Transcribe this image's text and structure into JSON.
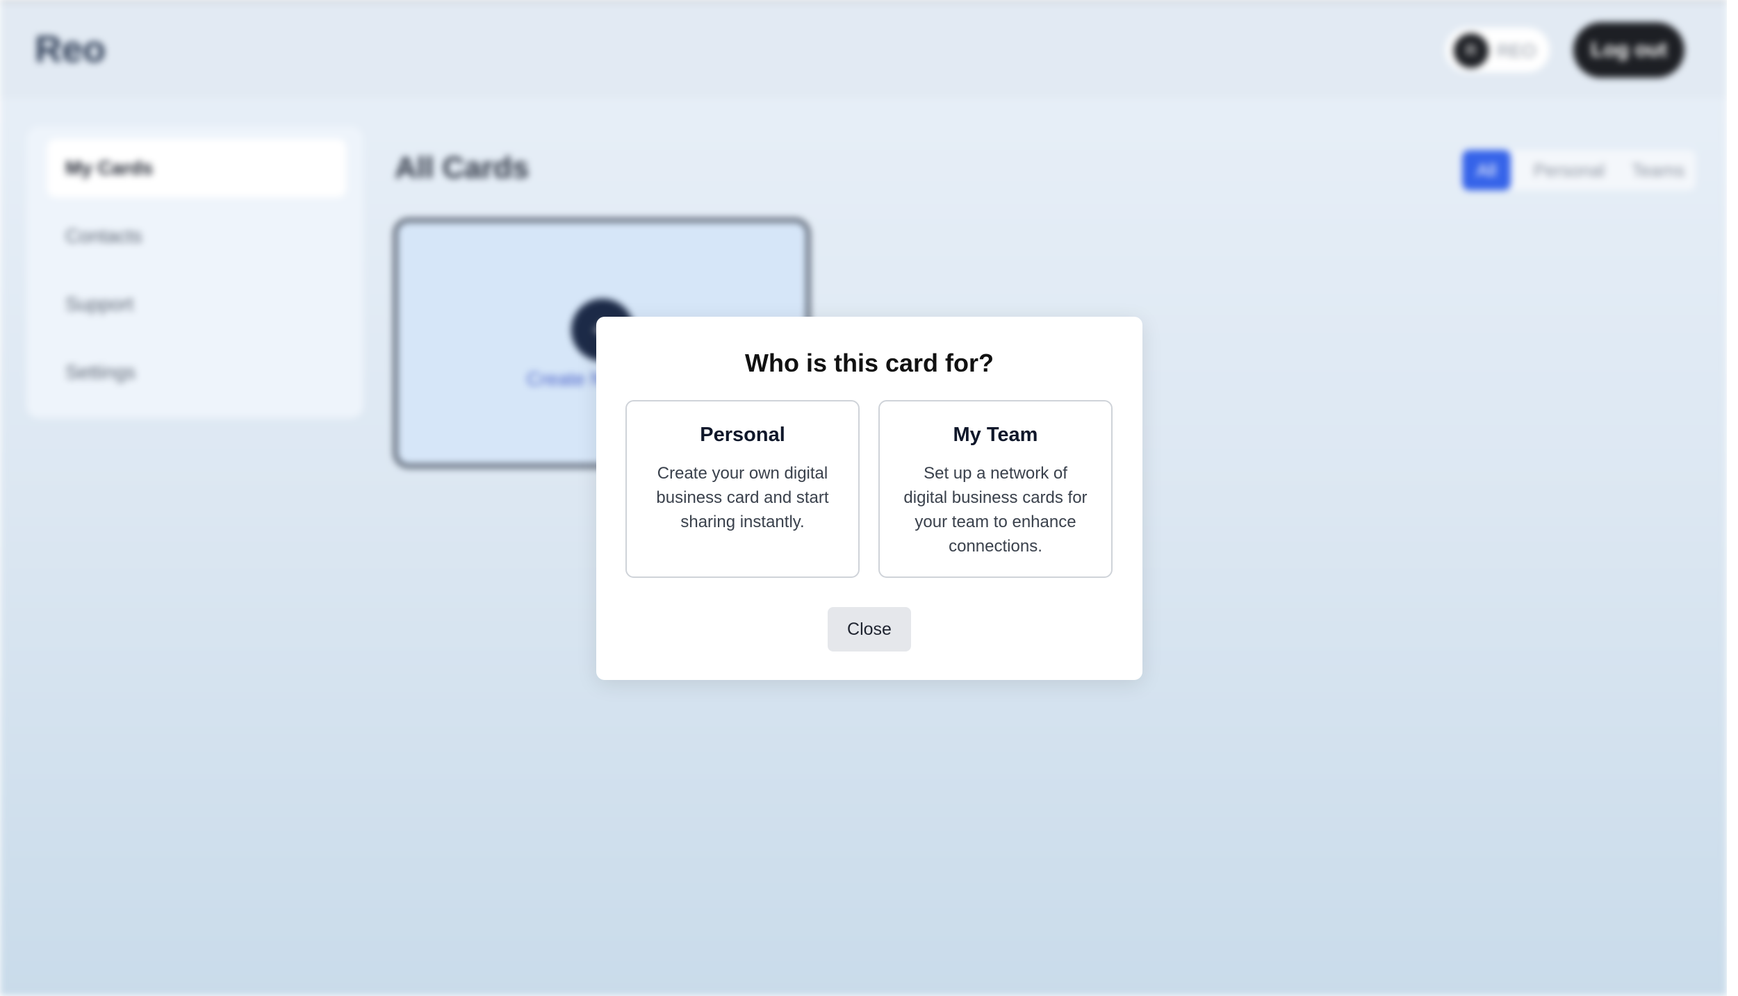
{
  "app": {
    "logo": "Reo",
    "user": {
      "initial": "R",
      "name": "REO"
    },
    "logout_label": "Log out"
  },
  "sidebar": {
    "items": [
      {
        "label": "My Cards",
        "active": true
      },
      {
        "label": "Contacts",
        "active": false
      },
      {
        "label": "Support",
        "active": false
      },
      {
        "label": "Settings",
        "active": false
      }
    ]
  },
  "main": {
    "title": "All Cards",
    "filters": [
      {
        "label": "All",
        "active": true
      },
      {
        "label": "Personal",
        "active": false
      },
      {
        "label": "Teams",
        "active": false
      }
    ],
    "create_card": {
      "icon": "plus-icon",
      "label": "Create New Card"
    }
  },
  "modal": {
    "title": "Who is this card for?",
    "options": [
      {
        "title": "Personal",
        "description": "Create your own digital business card and start sharing instantly."
      },
      {
        "title": "My Team",
        "description": "Set up a network of digital business cards for your team to enhance connections."
      }
    ],
    "close_label": "Close"
  },
  "colors": {
    "accent": "#3563e9",
    "dark": "#1d1f24",
    "backdrop_top": "#e9f0f8",
    "backdrop_bottom": "#c9dbea",
    "card_border": "#cfd3d9"
  }
}
